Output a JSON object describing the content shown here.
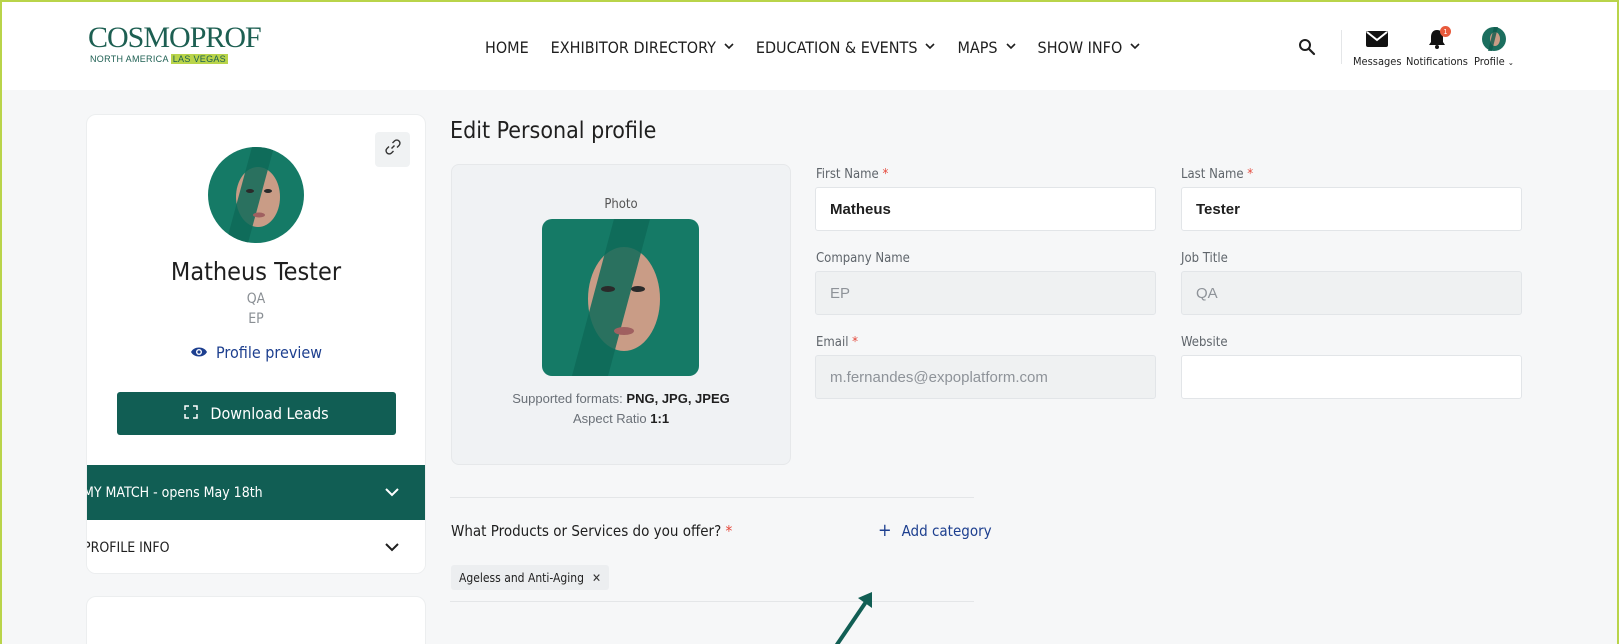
{
  "brand": {
    "logo_main": "COSMOPROF",
    "logo_sub_1": "NORTH AMERICA",
    "logo_sub_2": "LAS VEGAS",
    "colors": {
      "primary": "#115e54",
      "accent": "#b9d44a",
      "link": "#1d3f8f",
      "required": "#e4483b",
      "badge": "#e85a3c"
    }
  },
  "nav": {
    "items": [
      {
        "label": "HOME",
        "has_dropdown": false
      },
      {
        "label": "EXHIBITOR DIRECTORY",
        "has_dropdown": true
      },
      {
        "label": "EDUCATION & EVENTS",
        "has_dropdown": true
      },
      {
        "label": "MAPS",
        "has_dropdown": true
      },
      {
        "label": "SHOW INFO",
        "has_dropdown": true
      }
    ]
  },
  "header_actions": {
    "search_icon": "search-icon",
    "messages_label": "Messages",
    "notifications_label": "Notifications",
    "notifications_count": "1",
    "profile_label": "Profile"
  },
  "sidebar": {
    "name": "Matheus Tester",
    "job_title": "QA",
    "company": "EP",
    "preview_label": "Profile preview",
    "download_label": "Download Leads",
    "accordion": [
      {
        "label": "MY MATCH - opens May 18th",
        "active": true
      },
      {
        "label": "PROFILE INFO",
        "active": false
      }
    ]
  },
  "form": {
    "page_title": "Edit Personal profile",
    "photo_label": "Photo",
    "formats_prefix": "Supported formats:",
    "formats_value": "PNG, JPG, JPEG",
    "ratio_prefix": "Aspect Ratio",
    "ratio_value": "1:1",
    "first_name": {
      "label": "First Name",
      "value": "Matheus",
      "required": true
    },
    "last_name": {
      "label": "Last Name",
      "value": "Tester",
      "required": true
    },
    "company_name": {
      "label": "Company Name",
      "value": "EP",
      "disabled": true
    },
    "job_title": {
      "label": "Job Title",
      "value": "QA",
      "disabled": true
    },
    "email": {
      "label": "Email",
      "value": "m.fernandes@expoplatform.com",
      "required": true,
      "disabled": true
    },
    "website": {
      "label": "Website",
      "value": ""
    },
    "products_question": "What Products or Services do you offer?",
    "add_category_label": "Add category",
    "categories": [
      "Ageless and Anti-Aging"
    ]
  }
}
